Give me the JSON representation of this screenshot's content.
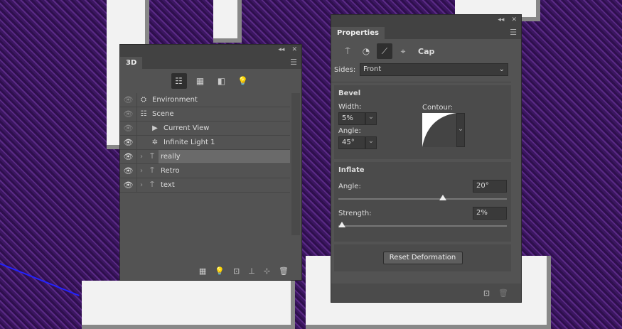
{
  "panel3d": {
    "tab": "3D",
    "collapse": "◂◂",
    "close": "✕",
    "layers": [
      {
        "name": "Environment",
        "icon": "environment-icon",
        "visible": false,
        "indent": 0
      },
      {
        "name": "Scene",
        "icon": "scene-icon",
        "visible": false,
        "indent": 0
      },
      {
        "name": "Current View",
        "icon": "camera-icon",
        "visible": false,
        "indent": 1
      },
      {
        "name": "Infinite Light 1",
        "icon": "light-icon",
        "visible": true,
        "indent": 1
      },
      {
        "name": "really",
        "icon": "mesh-icon",
        "visible": true,
        "indent": 0,
        "selected": true
      },
      {
        "name": "Retro",
        "icon": "mesh-icon",
        "visible": true,
        "indent": 0
      },
      {
        "name": "text",
        "icon": "mesh-icon",
        "visible": true,
        "indent": 0
      }
    ]
  },
  "properties": {
    "tab": "Properties",
    "mode": "Cap",
    "sides_label": "Sides:",
    "sides_value": "Front",
    "bevel": {
      "title": "Bevel",
      "width_label": "Width:",
      "width_value": "5%",
      "angle_label": "Angle:",
      "angle_value": "45°",
      "contour_label": "Contour:"
    },
    "inflate": {
      "title": "Inflate",
      "angle_label": "Angle:",
      "angle_value": "20°",
      "angle_fraction": 0.62,
      "strength_label": "Strength:",
      "strength_value": "2%",
      "strength_fraction": 0.02
    },
    "reset_label": "Reset Deformation"
  }
}
